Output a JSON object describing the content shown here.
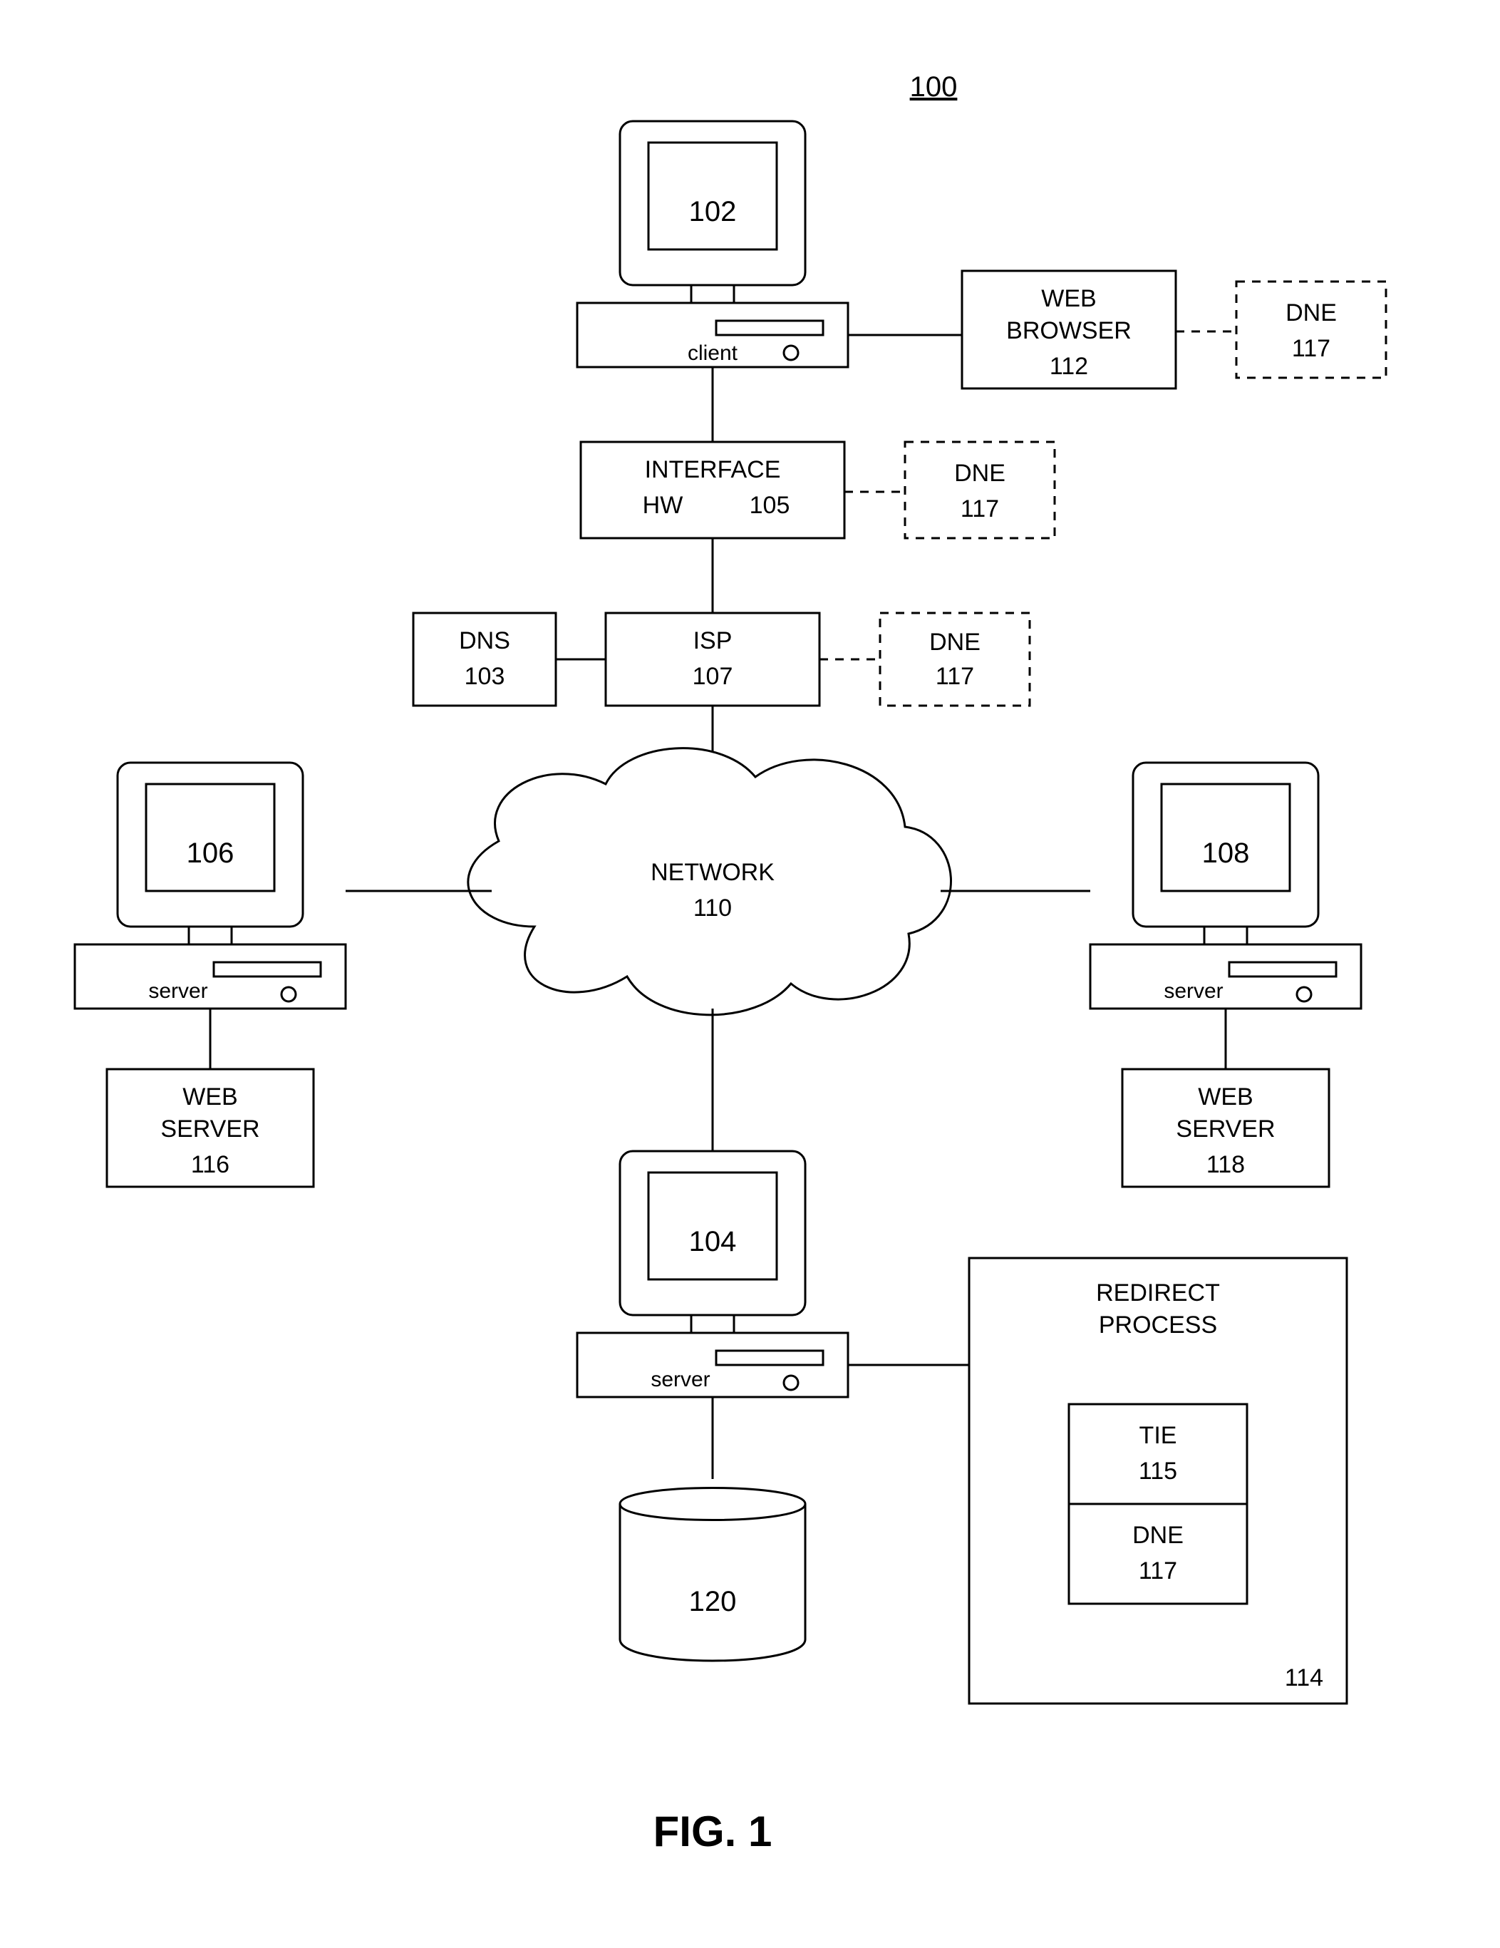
{
  "figure_ref": "100",
  "figure_label": "FIG.  1",
  "client": {
    "num": "102",
    "label": "client"
  },
  "web_browser": {
    "line1": "WEB",
    "line2": "BROWSER",
    "num": "112"
  },
  "dne": {
    "label": "DNE",
    "num": "117"
  },
  "interface": {
    "line1": "INTERFACE",
    "line2": "HW",
    "num": "105"
  },
  "dns": {
    "label": "DNS",
    "num": "103"
  },
  "isp": {
    "label": "ISP",
    "num": "107"
  },
  "network": {
    "label": "NETWORK",
    "num": "110"
  },
  "server_left": {
    "num": "106",
    "label": "server"
  },
  "server_right": {
    "num": "108",
    "label": "server"
  },
  "web_server_left": {
    "line1": "WEB",
    "line2": "SERVER",
    "num": "116"
  },
  "web_server_right": {
    "line1": "WEB",
    "line2": "SERVER",
    "num": "118"
  },
  "server_bottom": {
    "num": "104",
    "label": "server"
  },
  "db": {
    "num": "120"
  },
  "redirect": {
    "line1": "REDIRECT",
    "line2": "PROCESS",
    "num": "114"
  },
  "tie": {
    "label": "TIE",
    "num": "115"
  }
}
